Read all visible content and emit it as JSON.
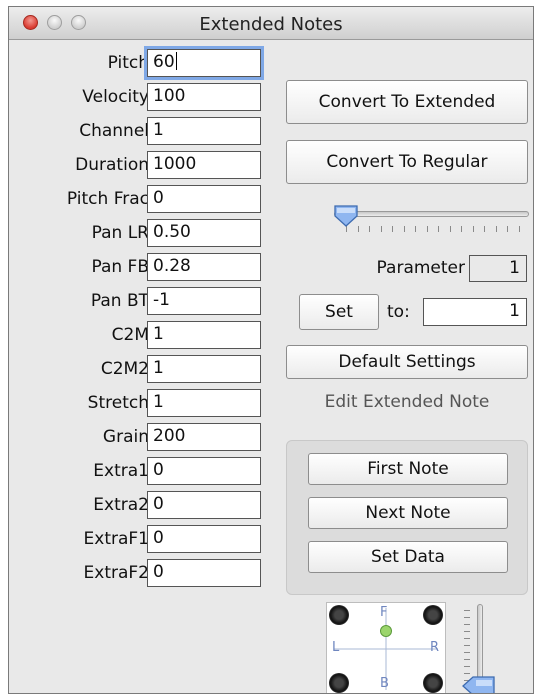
{
  "window": {
    "title": "Extended Notes"
  },
  "params": [
    {
      "label": "Pitch",
      "value": "60"
    },
    {
      "label": "Velocity",
      "value": "100"
    },
    {
      "label": "Channel",
      "value": "1"
    },
    {
      "label": "Duration",
      "value": "1000"
    },
    {
      "label": "Pitch Frac",
      "value": "0"
    },
    {
      "label": "Pan LR",
      "value": "0.50"
    },
    {
      "label": "Pan FB",
      "value": "0.28"
    },
    {
      "label": "Pan BT",
      "value": "-1"
    },
    {
      "label": "C2M",
      "value": "1"
    },
    {
      "label": "C2M2",
      "value": "1"
    },
    {
      "label": "Stretch",
      "value": "1"
    },
    {
      "label": "Grain",
      "value": "200"
    },
    {
      "label": "Extra1",
      "value": "0"
    },
    {
      "label": "Extra2",
      "value": "0"
    },
    {
      "label": "ExtraF1",
      "value": "0"
    },
    {
      "label": "ExtraF2",
      "value": "0"
    }
  ],
  "buttons": {
    "convert_extended": "Convert To Extended",
    "convert_regular": "Convert To Regular",
    "set": "Set",
    "default_settings": "Default Settings",
    "first_note": "First Note",
    "next_note": "Next Note",
    "set_data": "Set Data"
  },
  "parameter": {
    "label": "Parameter",
    "value": "1",
    "slider_level": 0.0
  },
  "set_to": {
    "label": "to:",
    "value": "1"
  },
  "edit_group": {
    "title": "Edit Extended Note"
  },
  "pan_pad": {
    "labels": {
      "front": "F",
      "back": "B",
      "left": "L",
      "right": "R"
    },
    "height_slider_level": 0.0
  },
  "colors": {
    "close": "#e0413a",
    "accent": "#7fa8e6"
  }
}
